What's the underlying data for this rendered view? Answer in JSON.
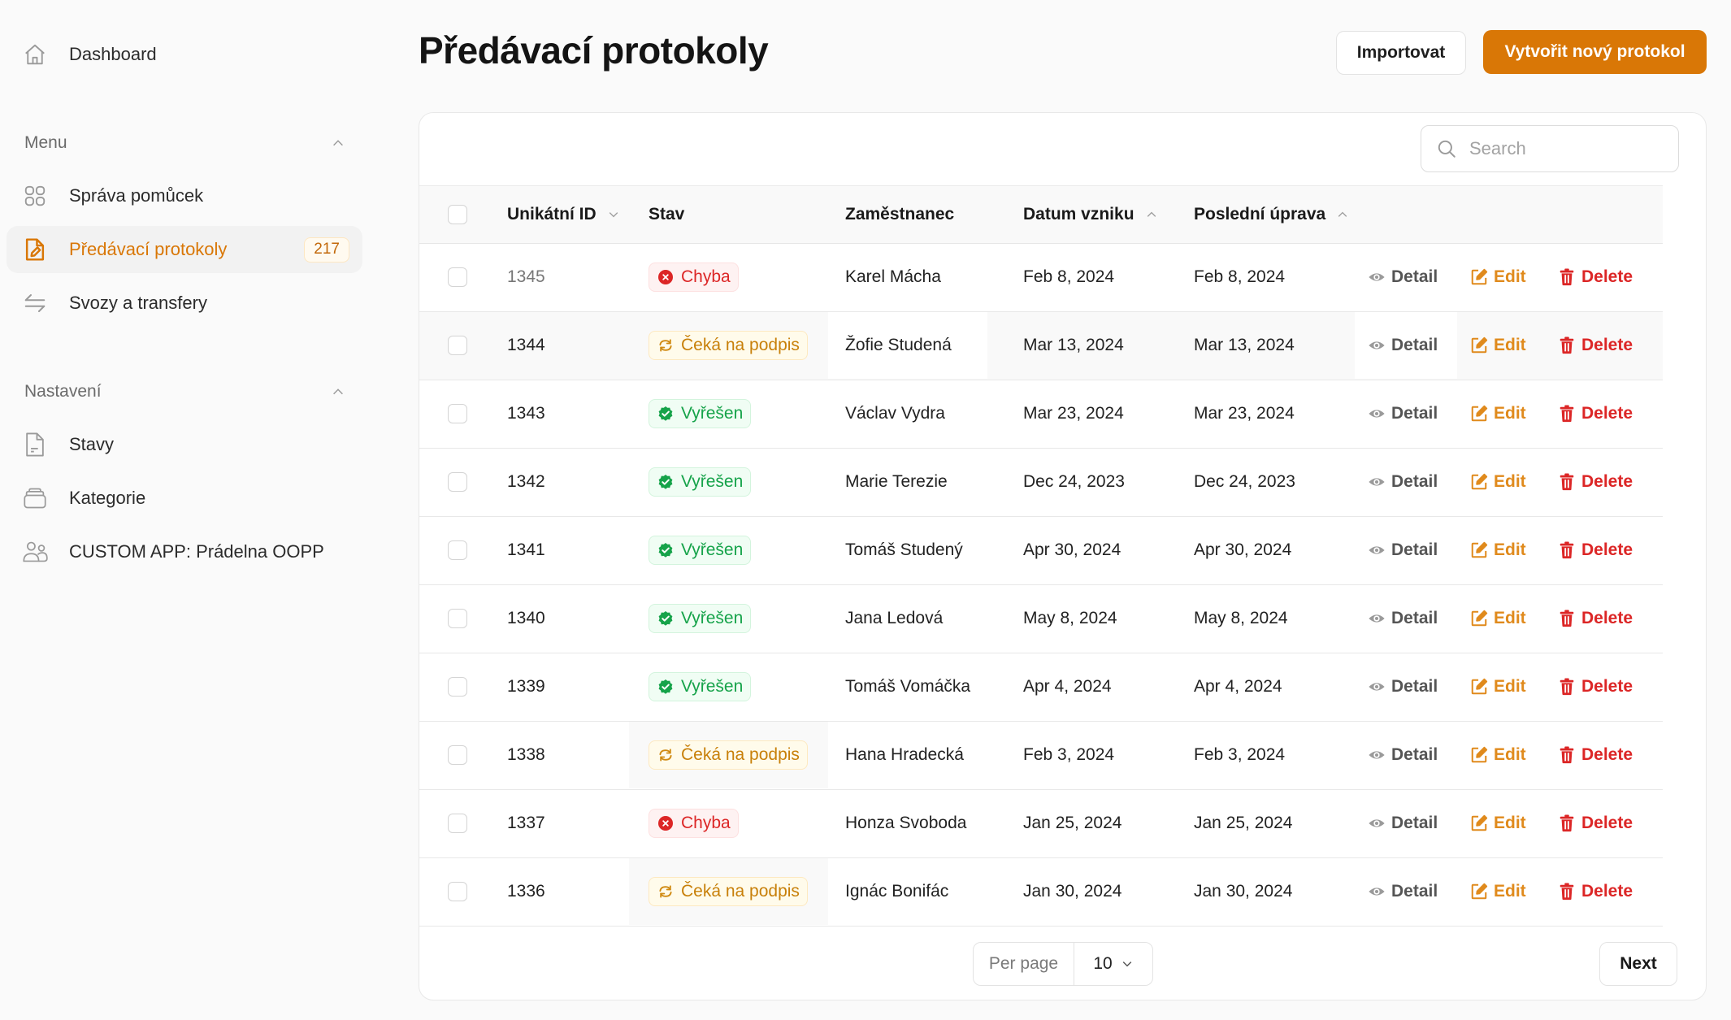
{
  "sidebar": {
    "dashboard": {
      "label": "Dashboard",
      "icon": "home-icon"
    },
    "sections": [
      {
        "label": "Menu",
        "expanded": true,
        "items": [
          {
            "label": "Správa pomůcek",
            "icon": "grid-icon",
            "active": false
          },
          {
            "label": "Předávací protokoly",
            "icon": "document-edit-icon",
            "active": true,
            "badge": "217"
          },
          {
            "label": "Svozy a transfery",
            "icon": "arrows-transfer-icon",
            "active": false
          }
        ]
      },
      {
        "label": "Nastavení",
        "expanded": true,
        "items": [
          {
            "label": "Stavy",
            "icon": "document-icon"
          },
          {
            "label": "Kategorie",
            "icon": "stack-icon"
          },
          {
            "label": "CUSTOM APP: Prádelna OOPP",
            "icon": "users-icon"
          }
        ]
      }
    ]
  },
  "header": {
    "title": "Předávací protokoly",
    "import_label": "Importovat",
    "create_label": "Vytvořit nový protokol"
  },
  "colors": {
    "accent": "#d97706",
    "error": "#dc2626",
    "pending": "#c8800a",
    "success": "#16a34a"
  },
  "search": {
    "placeholder": "Search",
    "value": ""
  },
  "table": {
    "columns": [
      {
        "label": "Unikátní ID",
        "sort": "desc"
      },
      {
        "label": "Stav",
        "sort": null
      },
      {
        "label": "Zaměstnanec",
        "sort": null
      },
      {
        "label": "Datum vzniku",
        "sort": "asc"
      },
      {
        "label": "Poslední úprava",
        "sort": "asc"
      }
    ],
    "actions": {
      "detail": "Detail",
      "edit": "Edit",
      "delete": "Delete"
    },
    "rows": [
      {
        "id": "1345",
        "status": "Chyba",
        "status_type": "error",
        "employee": "Karel Mácha",
        "created": "Feb 8, 2024",
        "modified": "Feb 8, 2024"
      },
      {
        "id": "1344",
        "status": "Čeká na podpis",
        "status_type": "pending",
        "employee": "Žofie Studená",
        "created": "Mar 13, 2024",
        "modified": "Mar 13, 2024"
      },
      {
        "id": "1343",
        "status": "Vyřešen",
        "status_type": "ok",
        "employee": "Václav Vydra",
        "created": "Mar 23, 2024",
        "modified": "Mar 23, 2024"
      },
      {
        "id": "1342",
        "status": "Vyřešen",
        "status_type": "ok",
        "employee": "Marie Terezie",
        "created": "Dec 24, 2023",
        "modified": "Dec 24, 2023"
      },
      {
        "id": "1341",
        "status": "Vyřešen",
        "status_type": "ok",
        "employee": "Tomáš Studený",
        "created": "Apr 30, 2024",
        "modified": "Apr 30, 2024"
      },
      {
        "id": "1340",
        "status": "Vyřešen",
        "status_type": "ok",
        "employee": "Jana Ledová",
        "created": "May 8, 2024",
        "modified": "May 8, 2024"
      },
      {
        "id": "1339",
        "status": "Vyřešen",
        "status_type": "ok",
        "employee": "Tomáš Vomáčka",
        "created": "Apr 4, 2024",
        "modified": "Apr 4, 2024"
      },
      {
        "id": "1338",
        "status": "Čeká na podpis",
        "status_type": "pending",
        "employee": "Hana Hradecká",
        "created": "Feb 3, 2024",
        "modified": "Feb 3, 2024"
      },
      {
        "id": "1337",
        "status": "Chyba",
        "status_type": "error",
        "employee": "Honza Svoboda",
        "created": "Jan 25, 2024",
        "modified": "Jan 25, 2024"
      },
      {
        "id": "1336",
        "status": "Čeká na podpis",
        "status_type": "pending",
        "employee": "Ignác Bonifác",
        "created": "Jan 30, 2024",
        "modified": "Jan 30, 2024"
      }
    ]
  },
  "pagination": {
    "per_page_label": "Per page",
    "per_page_value": "10",
    "next_label": "Next"
  }
}
